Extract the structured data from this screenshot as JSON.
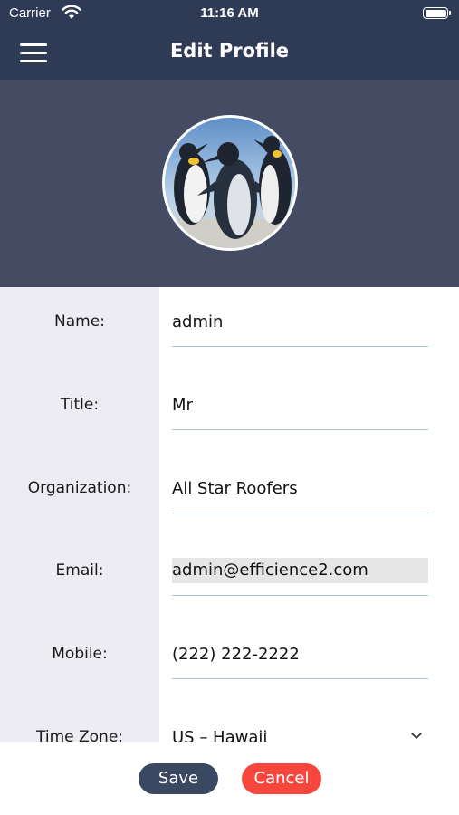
{
  "status_bar": {
    "carrier": "Carrier",
    "time": "11:16 AM"
  },
  "nav": {
    "title": "Edit Profile",
    "menu_icon": "hamburger-menu-icon"
  },
  "profile": {
    "avatar_description": "penguins-photo"
  },
  "form": {
    "fields": [
      {
        "label": "Name:",
        "value": "admin"
      },
      {
        "label": "Title:",
        "value": "Mr"
      },
      {
        "label": "Organization:",
        "value": "All Star Roofers"
      },
      {
        "label": "Email:",
        "value": "admin@efficience2.com",
        "disabled": true
      },
      {
        "label": "Mobile:",
        "value": "(222) 222-2222"
      },
      {
        "label": "Time Zone:",
        "value": "US – Hawaii",
        "type": "select"
      }
    ]
  },
  "footer": {
    "save_label": "Save",
    "cancel_label": "Cancel"
  },
  "colors": {
    "nav_bg": "#2f3b55",
    "header_bg": "#434c63",
    "label_col_bg": "#ececf2",
    "save_bg": "#3b4862",
    "cancel_bg": "#f7463e",
    "field_underline": "#a9c1e0"
  }
}
